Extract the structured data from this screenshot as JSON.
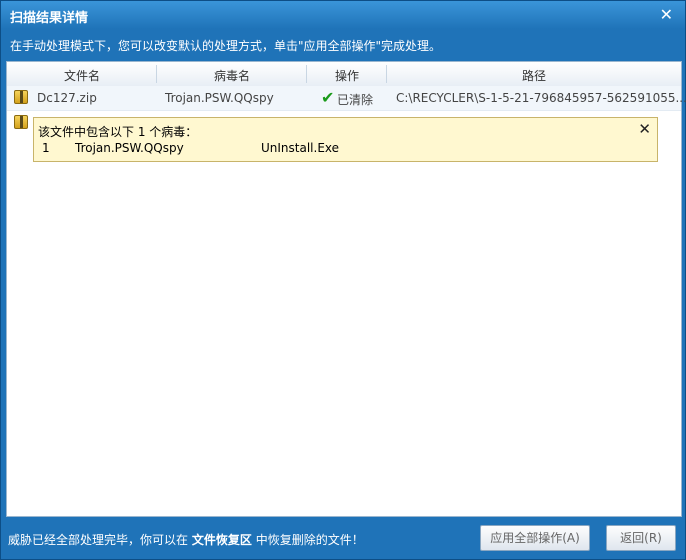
{
  "window": {
    "title": "扫描结果详情",
    "close_glyph": "✕"
  },
  "description": "在手动处理模式下，您可以改变默认的处理方式，单击\"应用全部操作\"完成处理。",
  "table": {
    "columns": [
      "文件名",
      "病毒名",
      "操作",
      "路径"
    ],
    "rows": [
      {
        "file": "Dc127.zip",
        "virus": "Trojan.PSW.QQspy",
        "action": "已清除",
        "path": "C:\\RECYCLER\\S-1-5-21-796845957-562591055..."
      },
      {
        "file": "",
        "virus": "",
        "action": "",
        "path": ""
      }
    ]
  },
  "tooltip": {
    "title": "该文件中包含以下 1 个病毒：",
    "index": "1",
    "virus": "Trojan.PSW.QQspy",
    "file": "UnInstall.Exe"
  },
  "footer": {
    "text_before": "威胁已经全部处理完毕，你可以在",
    "link": "文件恢复区",
    "text_after": "中恢复删除的文件！",
    "apply_button": "应用全部操作(A)",
    "return_button": "返回(R)"
  },
  "colors": {
    "background": "#1f73b8",
    "check": "#1a9a1a",
    "tooltip_bg": "#fff8d0"
  }
}
